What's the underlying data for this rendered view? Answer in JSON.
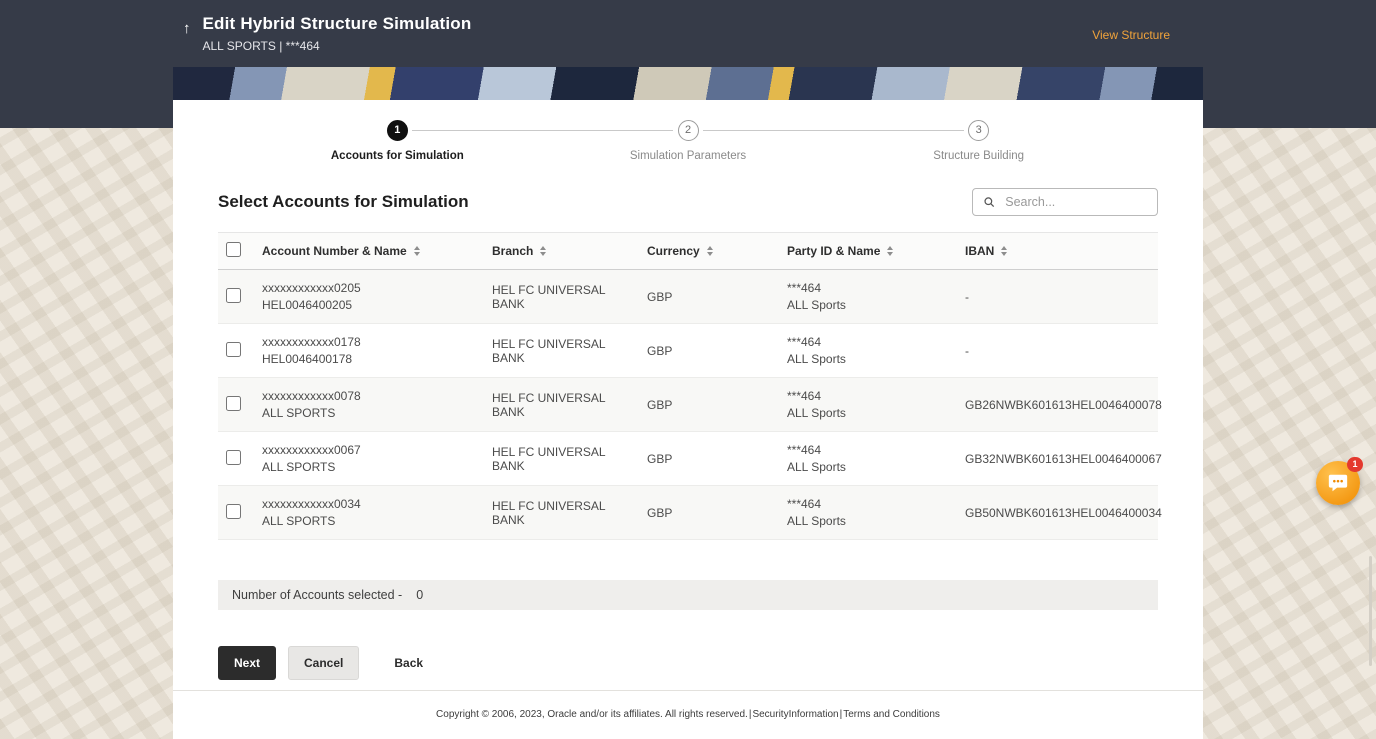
{
  "colors": {
    "header_bg": "#363b48",
    "accent_orange": "#f0a33b",
    "chat_fab_orange": "#f08b00",
    "badge_red": "#e4392e",
    "active_step_black": "#101010",
    "next_button_bg": "#2c2c2c",
    "card_bg": "#ffffff",
    "page_bg": "#efe9df"
  },
  "header": {
    "back_icon": "↑",
    "title": "Edit Hybrid Structure Simulation",
    "subtitle": "ALL SPORTS | ***464",
    "view_structure_link": "View Structure"
  },
  "stepper": {
    "steps": [
      {
        "number": "1",
        "label": "Accounts for Simulation"
      },
      {
        "number": "2",
        "label": "Simulation Parameters"
      },
      {
        "number": "3",
        "label": "Structure Building"
      }
    ]
  },
  "section": {
    "title": "Select Accounts for Simulation",
    "search_placeholder": "Search..."
  },
  "table": {
    "columns": [
      "Account Number & Name",
      "Branch",
      "Currency",
      "Party ID & Name",
      "IBAN"
    ],
    "rows": [
      {
        "account_number": "xxxxxxxxxxxx0205",
        "account_name": "HEL0046400205",
        "branch": "HEL FC UNIVERSAL BANK",
        "currency": "GBP",
        "party_id": "***464",
        "party_name": "ALL Sports",
        "iban": "-"
      },
      {
        "account_number": "xxxxxxxxxxxx0178",
        "account_name": "HEL0046400178",
        "branch": "HEL FC UNIVERSAL BANK",
        "currency": "GBP",
        "party_id": "***464",
        "party_name": "ALL Sports",
        "iban": "-"
      },
      {
        "account_number": "xxxxxxxxxxxx0078",
        "account_name": "ALL SPORTS",
        "branch": "HEL FC UNIVERSAL BANK",
        "currency": "GBP",
        "party_id": "***464",
        "party_name": "ALL Sports",
        "iban": "GB26NWBK601613HEL0046400078"
      },
      {
        "account_number": "xxxxxxxxxxxx0067",
        "account_name": "ALL SPORTS",
        "branch": "HEL FC UNIVERSAL BANK",
        "currency": "GBP",
        "party_id": "***464",
        "party_name": "ALL Sports",
        "iban": "GB32NWBK601613HEL0046400067"
      },
      {
        "account_number": "xxxxxxxxxxxx0034",
        "account_name": "ALL SPORTS",
        "branch": "HEL FC UNIVERSAL BANK",
        "currency": "GBP",
        "party_id": "***464",
        "party_name": "ALL Sports",
        "iban": "GB50NWBK601613HEL0046400034"
      }
    ]
  },
  "summary": {
    "label": "Number of Accounts selected -",
    "value": "0"
  },
  "buttons": {
    "next": "Next",
    "cancel": "Cancel",
    "back": "Back"
  },
  "footer": {
    "copyright": "Copyright © 2006, 2023, Oracle and/or its affiliates. All rights reserved.",
    "separator": "|",
    "security_link": "SecurityInformation",
    "terms_link": "Terms and Conditions"
  },
  "chat": {
    "badge_count": "1"
  }
}
